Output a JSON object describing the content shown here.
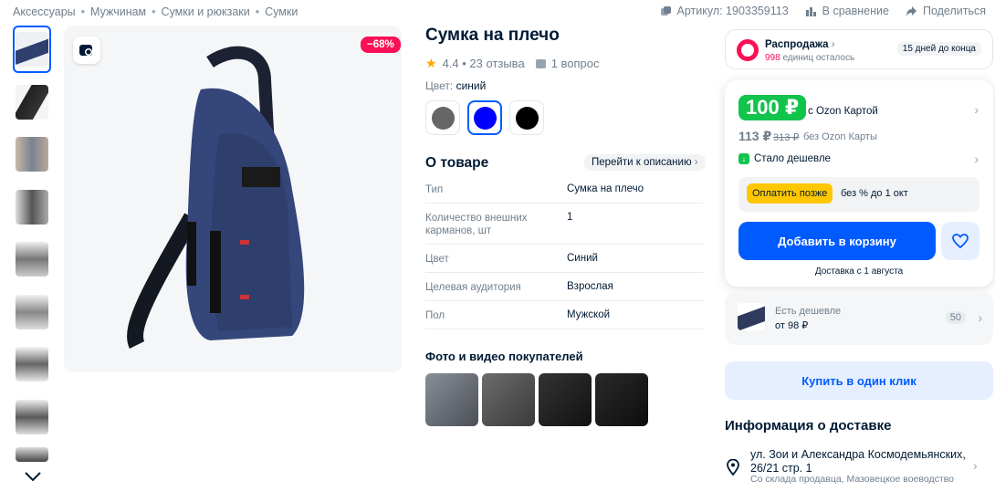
{
  "breadcrumbs": [
    "Аксессуары",
    "Мужчинам",
    "Сумки и рюкзаки",
    "Сумки"
  ],
  "breadcrumb_sep": "•",
  "toolbar": {
    "article": "Артикул: 1903359113",
    "compare": "В сравнение",
    "share": "Поделиться"
  },
  "gallery": {
    "discount": "−68%",
    "thumb_count": 9
  },
  "product": {
    "title": "Сумка на плечо",
    "rating": "4.4 • 23 отзыва",
    "questions": "1 вопрос",
    "color_label": "Цвет:",
    "color_value": "синий",
    "swatches": [
      "#666666",
      "#0000ff",
      "#000000"
    ]
  },
  "about": {
    "heading": "О товаре",
    "goto_label": "Перейти к описанию",
    "specs": [
      {
        "k": "Тип",
        "v": "Сумка на плечо"
      },
      {
        "k": "Количество внешних карманов, шт",
        "v": "1"
      },
      {
        "k": "Цвет",
        "v": "Синий"
      },
      {
        "k": "Целевая аудитория",
        "v": "Взрослая"
      },
      {
        "k": "Пол",
        "v": "Мужской"
      }
    ],
    "photos_heading": "Фото и видео покупателей"
  },
  "promo": {
    "title": "Распродажа",
    "remain_count": "998",
    "remain_text": "единиц осталось",
    "days": "15 дней до конца"
  },
  "price": {
    "ozon_price": "100 ₽",
    "ozon_label": "с Ozon Картой",
    "regular": "113 ₽",
    "old": "313 ₽",
    "no_card": "без Ozon Карты",
    "cheaper": "Стало дешевле",
    "pay_later": "Оплатить позже",
    "pay_later_text": "без % до 1 окт",
    "add_to_cart": "Добавить в корзину",
    "delivery": "Доставка с 1 августа"
  },
  "cheaper_offer": {
    "line1": "Есть дешевле",
    "line2": "от 98 ₽",
    "count": "50"
  },
  "buy_one_click": "Купить в один клик",
  "delivery_info": {
    "heading": "Информация о доставке",
    "address": "ул. Зои и Александра Космодемьянских, 26/21 стр. 1",
    "source": "Со склада продавца, Мазовецкое воеводство"
  },
  "colors": {
    "accent": "#005bff",
    "sale": "#f91155",
    "green": "#10c44c",
    "yellow": "#ffc700"
  }
}
